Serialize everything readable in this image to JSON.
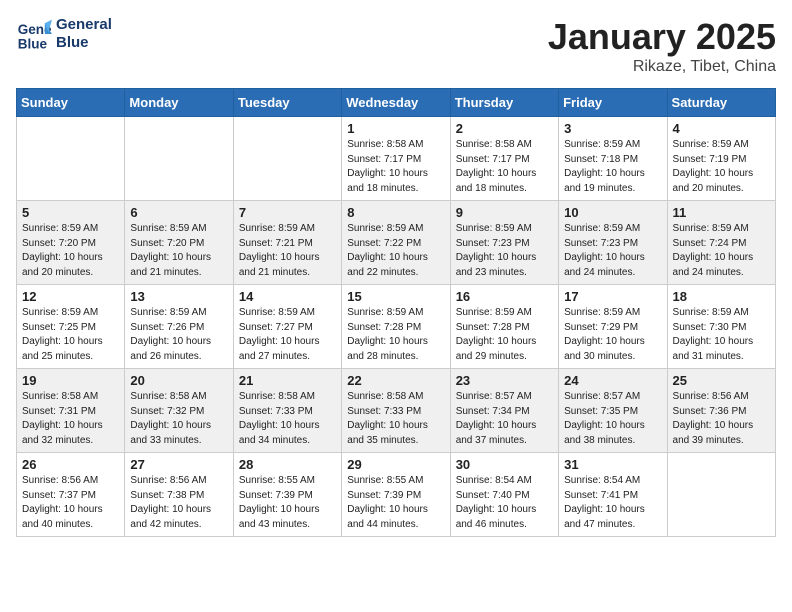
{
  "header": {
    "logo_line1": "General",
    "logo_line2": "Blue",
    "month": "January 2025",
    "location": "Rikaze, Tibet, China"
  },
  "days_of_week": [
    "Sunday",
    "Monday",
    "Tuesday",
    "Wednesday",
    "Thursday",
    "Friday",
    "Saturday"
  ],
  "weeks": [
    [
      {
        "num": "",
        "info": ""
      },
      {
        "num": "",
        "info": ""
      },
      {
        "num": "",
        "info": ""
      },
      {
        "num": "1",
        "info": "Sunrise: 8:58 AM\nSunset: 7:17 PM\nDaylight: 10 hours and 18 minutes."
      },
      {
        "num": "2",
        "info": "Sunrise: 8:58 AM\nSunset: 7:17 PM\nDaylight: 10 hours and 18 minutes."
      },
      {
        "num": "3",
        "info": "Sunrise: 8:59 AM\nSunset: 7:18 PM\nDaylight: 10 hours and 19 minutes."
      },
      {
        "num": "4",
        "info": "Sunrise: 8:59 AM\nSunset: 7:19 PM\nDaylight: 10 hours and 20 minutes."
      }
    ],
    [
      {
        "num": "5",
        "info": "Sunrise: 8:59 AM\nSunset: 7:20 PM\nDaylight: 10 hours and 20 minutes."
      },
      {
        "num": "6",
        "info": "Sunrise: 8:59 AM\nSunset: 7:20 PM\nDaylight: 10 hours and 21 minutes."
      },
      {
        "num": "7",
        "info": "Sunrise: 8:59 AM\nSunset: 7:21 PM\nDaylight: 10 hours and 21 minutes."
      },
      {
        "num": "8",
        "info": "Sunrise: 8:59 AM\nSunset: 7:22 PM\nDaylight: 10 hours and 22 minutes."
      },
      {
        "num": "9",
        "info": "Sunrise: 8:59 AM\nSunset: 7:23 PM\nDaylight: 10 hours and 23 minutes."
      },
      {
        "num": "10",
        "info": "Sunrise: 8:59 AM\nSunset: 7:23 PM\nDaylight: 10 hours and 24 minutes."
      },
      {
        "num": "11",
        "info": "Sunrise: 8:59 AM\nSunset: 7:24 PM\nDaylight: 10 hours and 24 minutes."
      }
    ],
    [
      {
        "num": "12",
        "info": "Sunrise: 8:59 AM\nSunset: 7:25 PM\nDaylight: 10 hours and 25 minutes."
      },
      {
        "num": "13",
        "info": "Sunrise: 8:59 AM\nSunset: 7:26 PM\nDaylight: 10 hours and 26 minutes."
      },
      {
        "num": "14",
        "info": "Sunrise: 8:59 AM\nSunset: 7:27 PM\nDaylight: 10 hours and 27 minutes."
      },
      {
        "num": "15",
        "info": "Sunrise: 8:59 AM\nSunset: 7:28 PM\nDaylight: 10 hours and 28 minutes."
      },
      {
        "num": "16",
        "info": "Sunrise: 8:59 AM\nSunset: 7:28 PM\nDaylight: 10 hours and 29 minutes."
      },
      {
        "num": "17",
        "info": "Sunrise: 8:59 AM\nSunset: 7:29 PM\nDaylight: 10 hours and 30 minutes."
      },
      {
        "num": "18",
        "info": "Sunrise: 8:59 AM\nSunset: 7:30 PM\nDaylight: 10 hours and 31 minutes."
      }
    ],
    [
      {
        "num": "19",
        "info": "Sunrise: 8:58 AM\nSunset: 7:31 PM\nDaylight: 10 hours and 32 minutes."
      },
      {
        "num": "20",
        "info": "Sunrise: 8:58 AM\nSunset: 7:32 PM\nDaylight: 10 hours and 33 minutes."
      },
      {
        "num": "21",
        "info": "Sunrise: 8:58 AM\nSunset: 7:33 PM\nDaylight: 10 hours and 34 minutes."
      },
      {
        "num": "22",
        "info": "Sunrise: 8:58 AM\nSunset: 7:33 PM\nDaylight: 10 hours and 35 minutes."
      },
      {
        "num": "23",
        "info": "Sunrise: 8:57 AM\nSunset: 7:34 PM\nDaylight: 10 hours and 37 minutes."
      },
      {
        "num": "24",
        "info": "Sunrise: 8:57 AM\nSunset: 7:35 PM\nDaylight: 10 hours and 38 minutes."
      },
      {
        "num": "25",
        "info": "Sunrise: 8:56 AM\nSunset: 7:36 PM\nDaylight: 10 hours and 39 minutes."
      }
    ],
    [
      {
        "num": "26",
        "info": "Sunrise: 8:56 AM\nSunset: 7:37 PM\nDaylight: 10 hours and 40 minutes."
      },
      {
        "num": "27",
        "info": "Sunrise: 8:56 AM\nSunset: 7:38 PM\nDaylight: 10 hours and 42 minutes."
      },
      {
        "num": "28",
        "info": "Sunrise: 8:55 AM\nSunset: 7:39 PM\nDaylight: 10 hours and 43 minutes."
      },
      {
        "num": "29",
        "info": "Sunrise: 8:55 AM\nSunset: 7:39 PM\nDaylight: 10 hours and 44 minutes."
      },
      {
        "num": "30",
        "info": "Sunrise: 8:54 AM\nSunset: 7:40 PM\nDaylight: 10 hours and 46 minutes."
      },
      {
        "num": "31",
        "info": "Sunrise: 8:54 AM\nSunset: 7:41 PM\nDaylight: 10 hours and 47 minutes."
      },
      {
        "num": "",
        "info": ""
      }
    ]
  ]
}
